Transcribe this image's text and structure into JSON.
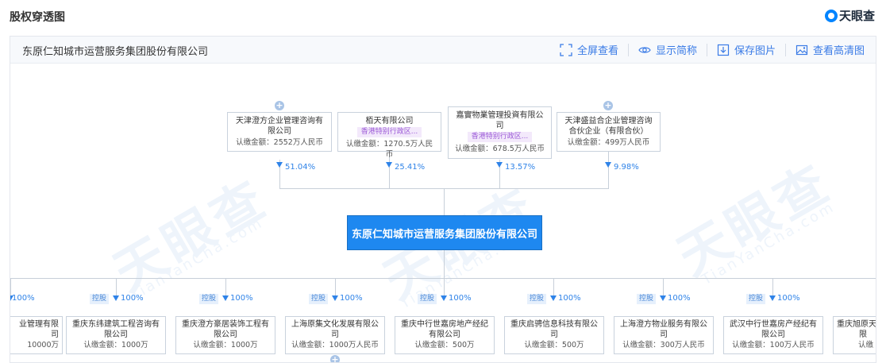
{
  "header": {
    "title": "股权穿透图",
    "brand": "天眼查"
  },
  "toolbar": {
    "company_name": "东原仁知城市运营服务集团股份有限公司",
    "fullscreen": "全屏查看",
    "simplified": "显示简称",
    "save_image": "保存图片",
    "hd_image": "查看高清图"
  },
  "watermark": {
    "text": "天眼查",
    "sub": "TianYanCha.com"
  },
  "shareholders": [
    {
      "name": "天津澄方企业管理咨询有",
      "name2": "限公司",
      "tag": "",
      "amount": "认缴金额：2552万人民币",
      "pct": "51.04%"
    },
    {
      "name": "栢天有限公司",
      "name2": "",
      "tag": "香港特别行政区...",
      "amount": "认缴金额：1270.5万人民币",
      "pct": "25.41%"
    },
    {
      "name": "嘉實物業管理投資有限公",
      "name2": "司",
      "tag": "香港特别行政区...",
      "amount": "认缴金额：678.5万人民币",
      "pct": "13.57%"
    },
    {
      "name": "天津盛益合企业管理咨询",
      "name2": "合伙企业（有限合伙）",
      "tag": "",
      "amount": "认缴金额：499万人民币",
      "pct": "9.98%"
    }
  ],
  "center": {
    "name": "东原仁知城市运营服务集团股份有限公司"
  },
  "subsidiaries": [
    {
      "name": "业管理有限",
      "name2": "司",
      "amount": "10000万",
      "pct": "100%",
      "ctrl": ""
    },
    {
      "name": "重庆东纬建筑工程咨询有",
      "name2": "限公司",
      "amount": "认缴金额：1000万",
      "pct": "100%",
      "ctrl": "控股"
    },
    {
      "name": "重庆澄方豪居装饰工程有",
      "name2": "限公司",
      "amount": "认缴金额：1000万",
      "pct": "100%",
      "ctrl": "控股"
    },
    {
      "name": "上海原集文化发展有限公",
      "name2": "司",
      "amount": "认缴金额：1000万人民币",
      "pct": "100%",
      "ctrl": "控股"
    },
    {
      "name": "重庆中行世嘉房地产经纪",
      "name2": "有限公司",
      "amount": "认缴金额：500万",
      "pct": "100%",
      "ctrl": "控股"
    },
    {
      "name": "重庆启骋信息科技有限公",
      "name2": "司",
      "amount": "认缴金额：500万",
      "pct": "100%",
      "ctrl": "控股"
    },
    {
      "name": "上海澄方物业服务有限公",
      "name2": "司",
      "amount": "认缴金额：300万人民币",
      "pct": "100%",
      "ctrl": "控股"
    },
    {
      "name": "武汉中行世嘉房产经纪有",
      "name2": "限公司",
      "amount": "认缴金额：100万人民币",
      "pct": "100%",
      "ctrl": "控股"
    },
    {
      "name": "重庆旭原天",
      "name2": "限",
      "amount": "认缴",
      "pct": "",
      "ctrl": ""
    }
  ],
  "icons": {
    "fullscreen": "fullscreen-icon",
    "eye": "eye-icon",
    "download": "download-icon",
    "image": "image-icon",
    "expand": "plus-icon"
  },
  "colors": {
    "accent": "#1e88f0",
    "link": "#3a7be6",
    "tag_bg": "#f3e9fb",
    "tag_text": "#9a58d6"
  }
}
